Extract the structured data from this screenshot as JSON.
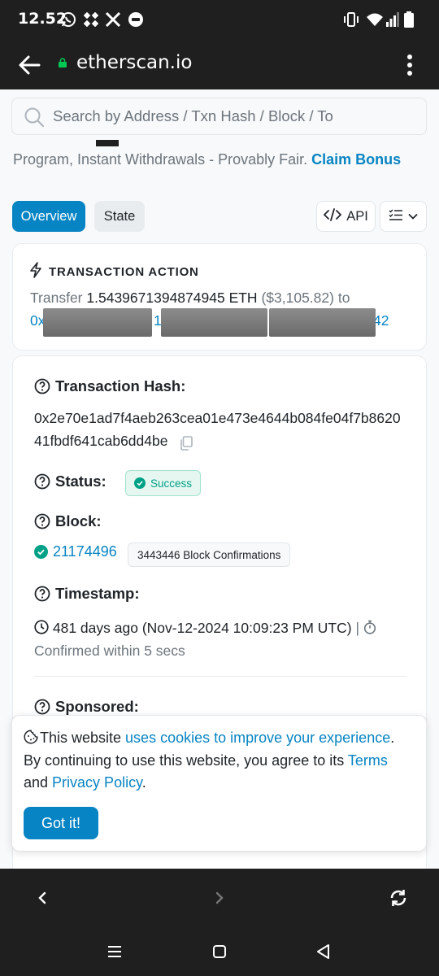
{
  "status_bar": {
    "time": "12.52",
    "icons": [
      "whatsapp-icon",
      "app-icon",
      "x-icon",
      "message-icon",
      "vibrate-icon",
      "wifi-icon",
      "signal-icon",
      "battery-icon"
    ]
  },
  "browser": {
    "url": "etherscan.io",
    "icons": [
      "back-arrow-icon",
      "lock-icon",
      "more-vert-icon"
    ]
  },
  "search": {
    "placeholder": "Search by Address / Txn Hash / Block / To"
  },
  "promo": {
    "text": "Program, Instant Withdrawals - Provably Fair.",
    "link": "Claim Bonus"
  },
  "tabs": {
    "overview": "Overview",
    "state": "State",
    "api": "API"
  },
  "action": {
    "heading": "TRANSACTION ACTION",
    "verb": "Transfer",
    "amount": "1.5439671394874945 ETH",
    "usd": "($3,105.82)",
    "to_word": "to",
    "addr_start": "0x",
    "addr_mid": "1",
    "addr_end": "42"
  },
  "details": {
    "hash_label": "Transaction Hash:",
    "hash": "0x2e70e1ad7f4aeb263cea01e473e4644b084fe04f7b862041fbdf641cab6dd4be",
    "status_label": "Status:",
    "status": "Success",
    "block_label": "Block:",
    "block": "21174496",
    "confirmations": "3443446 Block Confirmations",
    "timestamp_label": "Timestamp:",
    "timestamp": "481 days ago (Nov-12-2024 10:09:23 PM UTC)",
    "separator": "|",
    "confirmed": "Confirmed within 5 secs",
    "sponsored_label": "Sponsored:"
  },
  "cookie": {
    "t1": "This website ",
    "l1": "uses cookies to improve your experience",
    "t2": ". By continuing to use this website, you agree to its ",
    "l2": "Terms",
    "t3": " and ",
    "l3": "Privacy Policy",
    "t4": ".",
    "button": "Got it!"
  },
  "colors": {
    "accent": "#0784c3",
    "success": "#00a186",
    "chrome": "#1f1f1f"
  }
}
